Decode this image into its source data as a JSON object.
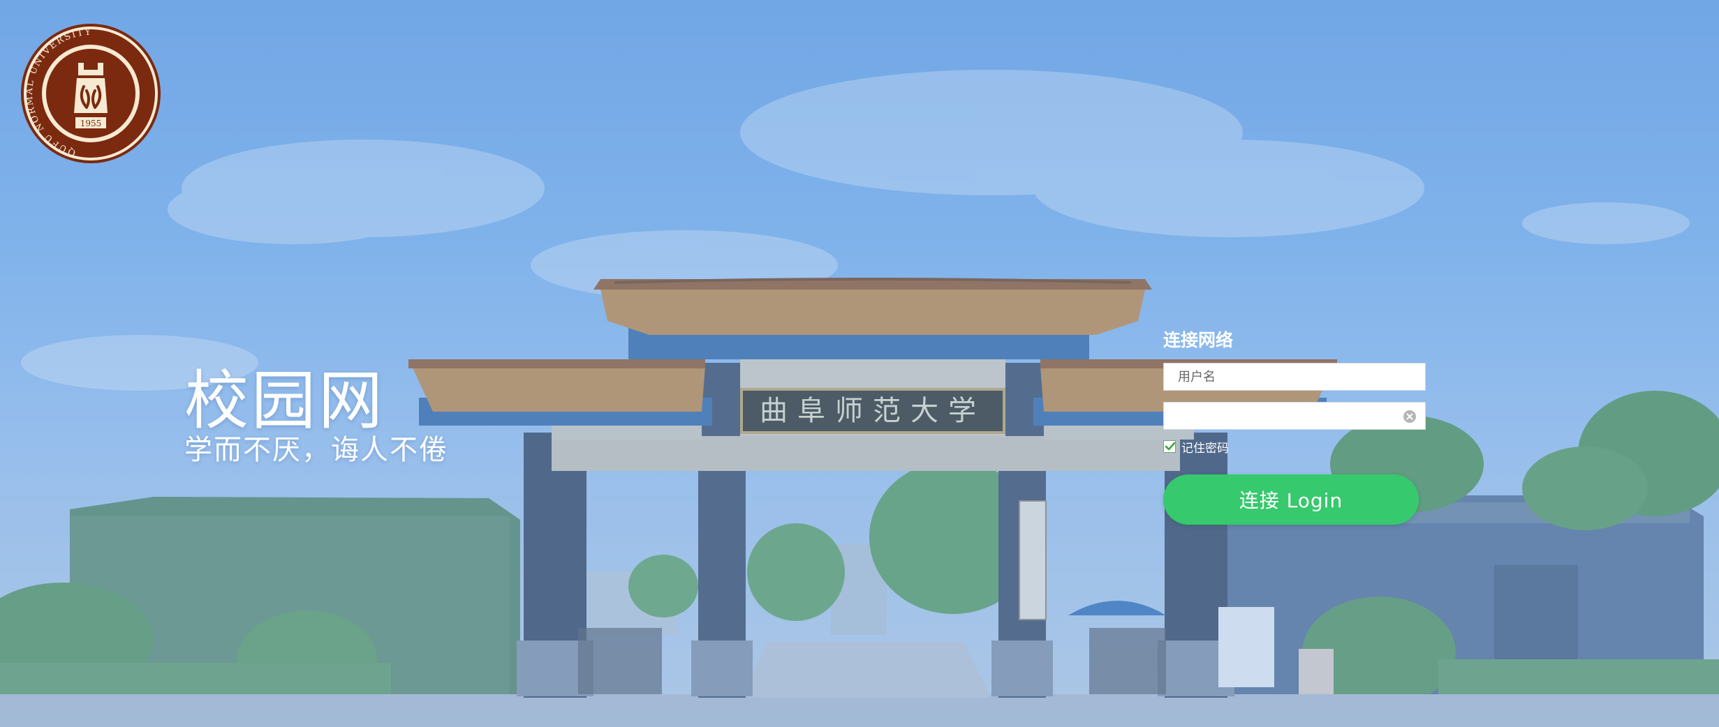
{
  "logo": {
    "ring_text": "QUFU NORMAL UNIVERSITY",
    "year": "1955",
    "brand_color": "#7b2a10"
  },
  "hero": {
    "title": "校园网",
    "subtitle": "学而不厌，诲人不倦"
  },
  "login": {
    "title": "连接网络",
    "username_placeholder": "用户名",
    "username_value": "",
    "password_value": "",
    "remember_label": "记住密码",
    "remember_checked": true,
    "button_label": "连接 Login"
  },
  "background": {
    "gate_plaque": "曲阜师范大学"
  },
  "colors": {
    "accent_green": "#37c96d",
    "sky_blue": "#86b8ee"
  }
}
